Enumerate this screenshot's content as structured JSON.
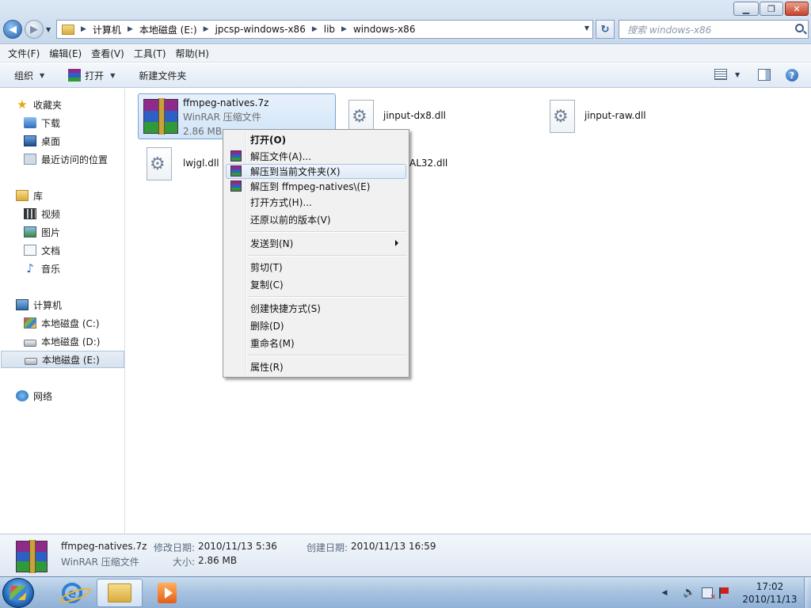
{
  "window": {
    "controls": {
      "minimize": "▁",
      "maximize": "❐",
      "close": "✕"
    }
  },
  "address": {
    "crumbs": [
      "计算机",
      "本地磁盘 (E:)",
      "jpcsp-windows-x86",
      "lib",
      "windows-x86"
    ],
    "search_placeholder": "搜索 windows-x86"
  },
  "menubar": {
    "items": [
      "文件(F)",
      "编辑(E)",
      "查看(V)",
      "工具(T)",
      "帮助(H)"
    ]
  },
  "commandbar": {
    "organize": "组织",
    "open": "打开",
    "new_folder": "新建文件夹"
  },
  "navpane": {
    "favorites": "收藏夹",
    "favorites_items": [
      "下载",
      "桌面",
      "最近访问的位置"
    ],
    "libraries": "库",
    "library_items": [
      "视频",
      "图片",
      "文档",
      "音乐"
    ],
    "computer": "计算机",
    "drives": [
      "本地磁盘 (C:)",
      "本地磁盘 (D:)",
      "本地磁盘 (E:)"
    ],
    "network": "网络"
  },
  "files": [
    {
      "name": "ffmpeg-natives.7z",
      "type": "WinRAR 压缩文件",
      "size": "2.86 MB",
      "icon": "winrar-archive-icon"
    },
    {
      "name": "jinput-dx8.dll",
      "icon": "dll-gear-icon"
    },
    {
      "name": "jinput-raw.dll",
      "icon": "dll-gear-icon"
    },
    {
      "name": "lwjgl.dll",
      "icon": "dll-gear-icon"
    },
    {
      "name": "OpenAL32.dll",
      "visible_fragment": "AL32.dll",
      "icon": "dll-gear-icon"
    }
  ],
  "context_menu": {
    "items": [
      {
        "label": "打开(O)",
        "bold": true
      },
      {
        "label": "解压文件(A)...",
        "icon": "winrar"
      },
      {
        "label": "解压到当前文件夹(X)",
        "icon": "winrar",
        "highlighted": true
      },
      {
        "label": "解压到 ffmpeg-natives\\(E)",
        "icon": "winrar"
      },
      {
        "label": "打开方式(H)..."
      },
      {
        "label": "还原以前的版本(V)"
      },
      {
        "label": "发送到(N)",
        "submenu": true
      },
      {
        "label": "剪切(T)"
      },
      {
        "label": "复制(C)"
      },
      {
        "label": "创建快捷方式(S)"
      },
      {
        "label": "删除(D)"
      },
      {
        "label": "重命名(M)"
      },
      {
        "label": "属性(R)"
      }
    ]
  },
  "details": {
    "name": "ffmpeg-natives.7z",
    "type": "WinRAR 压缩文件",
    "modified_label": "修改日期:",
    "modified_value": "2010/11/13 5:36",
    "created_label": "创建日期:",
    "created_value": "2010/11/13 16:59",
    "size_label": "大小:",
    "size_value": "2.86 MB"
  },
  "taskbar": {
    "time": "17:02",
    "date": "2010/11/13",
    "pinned": [
      "internet-explorer-icon",
      "windows-explorer-icon",
      "media-player-icon"
    ]
  },
  "colors": {
    "winrar_stripes": [
      "#8e2b8a",
      "#2d5fc4",
      "#2f9a3a"
    ],
    "selection": "#d0e4f8",
    "titlebar": "#c6d8ec"
  }
}
